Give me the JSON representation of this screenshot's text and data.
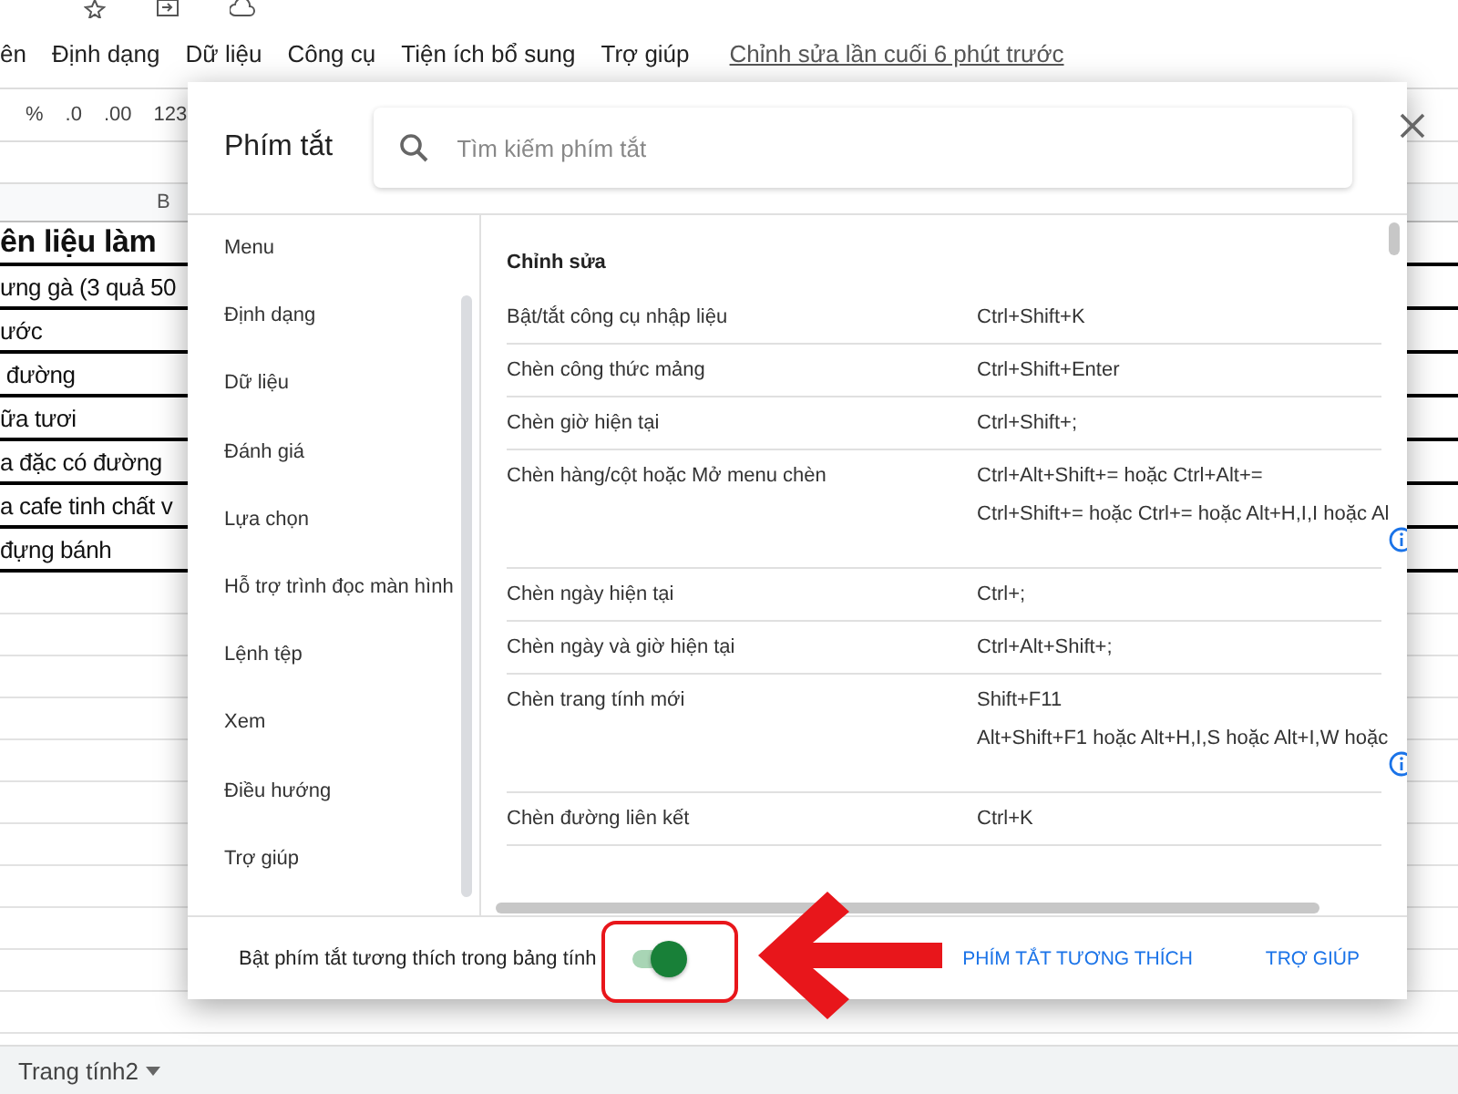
{
  "menu_bar": {
    "items": [
      "ên",
      "Định dạng",
      "Dữ liệu",
      "Công cụ",
      "Tiện ích bổ sung",
      "Trợ giúp"
    ],
    "last_edit": "Chỉnh sửa lần cuối 6 phút trước"
  },
  "toolbar": {
    "items": [
      "%",
      ".0",
      ".00",
      "123"
    ]
  },
  "sheet": {
    "column_header": "B",
    "cells": [
      {
        "text": "ên liệu làm",
        "bold": true
      },
      {
        "text": "ưng gà (3 quả 50",
        "bold": false
      },
      {
        "text": "ước",
        "bold": false
      },
      {
        "text": " đường",
        "bold": false
      },
      {
        "text": "ữa tươi",
        "bold": false
      },
      {
        "text": "a đặc có đường",
        "bold": false
      },
      {
        "text": "a cafe tinh chất v",
        "bold": false
      },
      {
        "text": "đựng bánh",
        "bold": false
      }
    ],
    "sheet_tab": "Trang tính2"
  },
  "dialog": {
    "title": "Phím tắt",
    "search": {
      "placeholder": "Tìm kiếm phím tắt"
    },
    "nav": [
      "Menu",
      "Định dạng",
      "Dữ liệu",
      "Đánh giá",
      "Lựa chọn",
      "Hỗ trợ trình đọc màn hình",
      "Lệnh tệp",
      "Xem",
      "Điều hướng",
      "Trợ giúp"
    ],
    "section": "Chỉnh sửa",
    "shortcuts": [
      {
        "action": "Bật/tắt công cụ nhập liệu",
        "keys": [
          "Ctrl+Shift+K"
        ],
        "info": false
      },
      {
        "action": "Chèn công thức mảng",
        "keys": [
          "Ctrl+Shift+Enter"
        ],
        "info": false
      },
      {
        "action": "Chèn giờ hiện tại",
        "keys": [
          "Ctrl+Shift+;"
        ],
        "info": false
      },
      {
        "action": "Chèn hàng/cột hoặc Mở menu chèn",
        "keys": [
          "Ctrl+Alt+Shift+= hoặc Ctrl+Alt+=",
          "Ctrl+Shift+= hoặc Ctrl+= hoặc Alt+H,I,I hoặc Al"
        ],
        "info": true
      },
      {
        "action": "Chèn ngày hiện tại",
        "keys": [
          "Ctrl+;"
        ],
        "info": false
      },
      {
        "action": "Chèn ngày và giờ hiện tại",
        "keys": [
          "Ctrl+Alt+Shift+;"
        ],
        "info": false
      },
      {
        "action": "Chèn trang tính mới",
        "keys": [
          "Shift+F11",
          "Alt+Shift+F1 hoặc Alt+H,I,S hoặc Alt+I,W hoặc"
        ],
        "info": true
      },
      {
        "action": "Chèn đường liên kết",
        "keys": [
          "Ctrl+K"
        ],
        "info": false
      }
    ],
    "footer": {
      "toggle_label": "Bật phím tắt tương thích trong bảng tính",
      "toggle_on": true,
      "buttons": [
        "PHÍM TẮT TƯƠNG THÍCH",
        "TRỢ GIÚP"
      ]
    }
  }
}
